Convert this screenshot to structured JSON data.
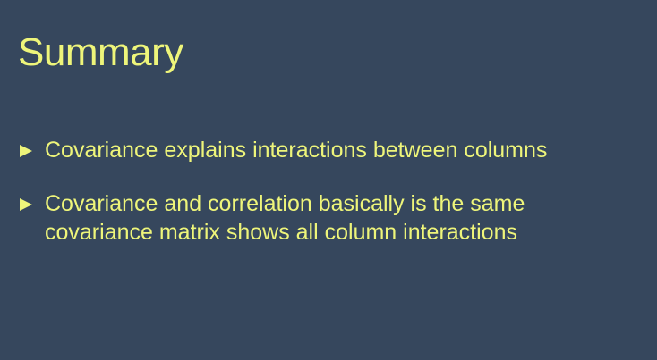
{
  "slide": {
    "title": "Summary",
    "bullets": [
      {
        "lines": [
          "Covariance explains interactions between columns"
        ]
      },
      {
        "lines": [
          "Covariance and correlation basically is the same",
          "covariance matrix shows all column interactions"
        ]
      }
    ]
  },
  "colors": {
    "background": "#36475d",
    "text": "#eef57a"
  },
  "icons": {
    "bullet": "triangle-right-icon"
  }
}
